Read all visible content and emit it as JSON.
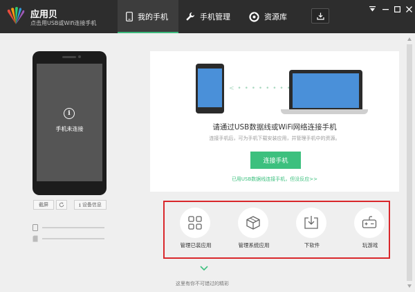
{
  "header": {
    "app_name": "应用贝",
    "app_subtitle": "点击用USB或Wifi连接手机",
    "tabs": [
      {
        "label": "我的手机",
        "icon": "phone-icon",
        "active": true
      },
      {
        "label": "手机管理",
        "icon": "wrench-icon",
        "active": false
      },
      {
        "label": "资源库",
        "icon": "resource-icon",
        "active": false
      }
    ],
    "accent_color": "#3bba7c"
  },
  "device": {
    "status_text": "手机未连接",
    "buttons": {
      "screenshot": "截屏",
      "device_info": "设备信息"
    }
  },
  "connect": {
    "title": "请通过USB数据线或WiFi网络连接手机",
    "description": "连接手机后，可为手机下载安装应用，并管理手机中的资源。",
    "button_label": "连接手机",
    "link_text": "已用USB数据线连接手机，但没反应>>",
    "button_color": "#3cc07e"
  },
  "quick_actions": [
    {
      "label": "管理已装应用",
      "icon": "grid-icon"
    },
    {
      "label": "管理系统应用",
      "icon": "box-icon"
    },
    {
      "label": "下软件",
      "icon": "download-tray-icon"
    },
    {
      "label": "玩游戏",
      "icon": "gamepad-icon"
    }
  ],
  "footer": {
    "more_text": "这里有你不可错过的精彩"
  }
}
